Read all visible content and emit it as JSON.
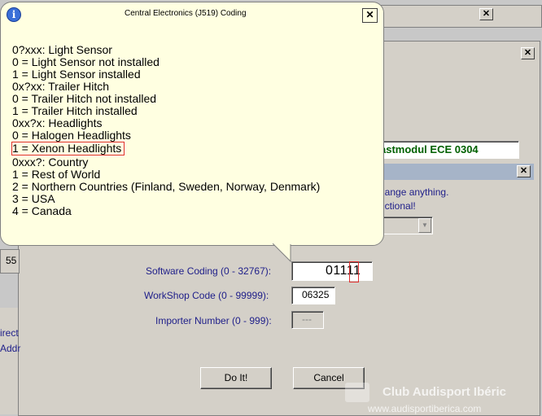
{
  "tooltip": {
    "title": "Central Electronics (J519) Coding",
    "lines": [
      "0?xxx: Light Sensor",
      "0 = Light Sensor not installed",
      "1 = Light Sensor installed",
      "0x?xx: Trailer Hitch",
      "0 = Trailer Hitch not installed",
      "1 = Trailer Hitch installed",
      "0xx?x: Headlights",
      "0 = Halogen Headlights",
      "1 = Xenon Headlights",
      "0xxx?: Country",
      "1 = Rest of World",
      "2 = Northern Countries (Finland, Sweden, Norway, Denmark)",
      "3 = USA",
      "4 = Canada"
    ],
    "close_symbol": "✕",
    "info_symbol": "i"
  },
  "background": {
    "component_text": "astmodul  ECE 0304",
    "warning_line1": "hange anything.",
    "warning_line2": "nctional!",
    "left_number": "55",
    "left_text1": "irect",
    "left_text2": "Addr"
  },
  "dialog": {
    "software_coding_label": "Software Coding (0 - 32767):",
    "software_coding_value": "01111",
    "workshop_code_label": "WorkShop Code (0 - 99999):",
    "workshop_code_value": "06325",
    "importer_number_label": "Importer Number (0 - 999):",
    "importer_number_value": "---",
    "do_it_label": "Do It!",
    "cancel_label": "Cancel"
  },
  "watermark": {
    "line1": "Club Audisport Ibéric",
    "line2": "www.audisportiberica.com"
  },
  "colors": {
    "tooltip_bg": "#ffffe1",
    "highlight_border": "#e03030",
    "label_text": "#20208a",
    "component_text": "#006000"
  }
}
